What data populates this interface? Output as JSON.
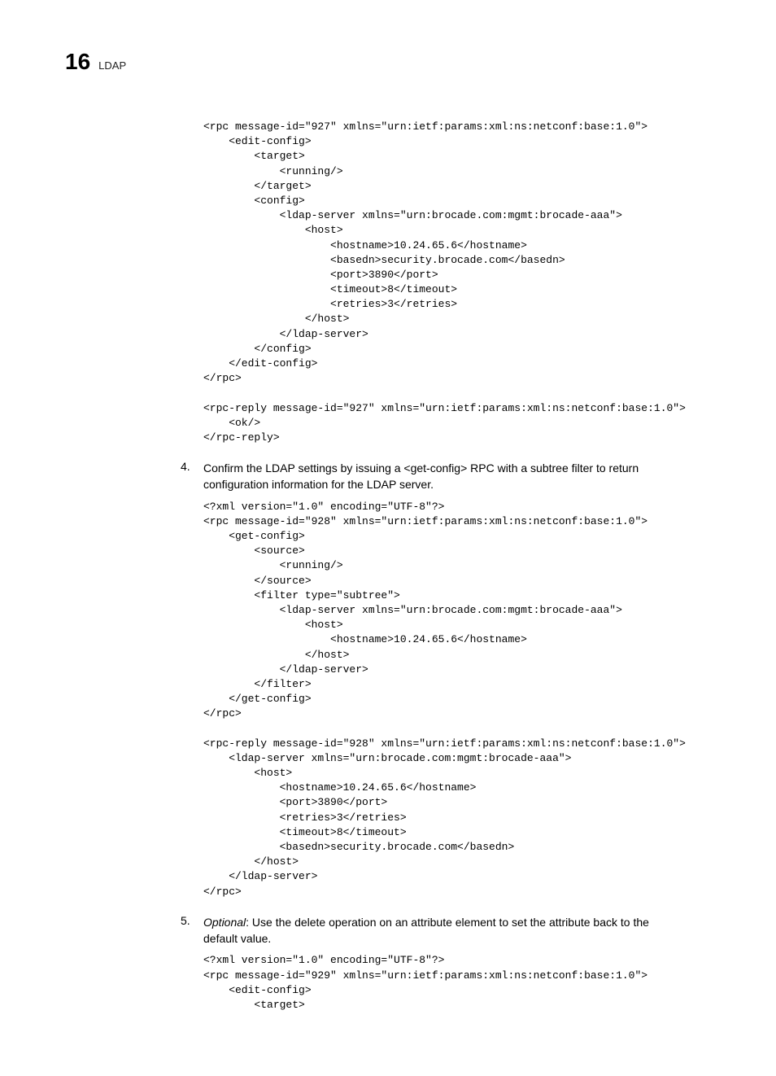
{
  "header": {
    "chapter_number": "16",
    "chapter_title": "LDAP"
  },
  "code_block_1": "<rpc message-id=\"927\" xmlns=\"urn:ietf:params:xml:ns:netconf:base:1.0\">\n    <edit-config>\n        <target>\n            <running/>\n        </target>\n        <config>\n            <ldap-server xmlns=\"urn:brocade.com:mgmt:brocade-aaa\">\n                <host>\n                    <hostname>10.24.65.6</hostname>\n                    <basedn>security.brocade.com</basedn>\n                    <port>3890</port>\n                    <timeout>8</timeout>\n                    <retries>3</retries>\n                </host>\n            </ldap-server>\n        </config>\n    </edit-config>\n</rpc>\n\n<rpc-reply message-id=\"927\" xmlns=\"urn:ietf:params:xml:ns:netconf:base:1.0\">\n    <ok/>\n</rpc-reply>",
  "step_4": {
    "num": "4.",
    "text": "Confirm the LDAP settings by issuing a <get-config> RPC with a subtree filter to return configuration information for the LDAP server."
  },
  "code_block_2": "<?xml version=\"1.0\" encoding=\"UTF-8\"?>\n<rpc message-id=\"928\" xmlns=\"urn:ietf:params:xml:ns:netconf:base:1.0\">\n    <get-config>\n        <source>\n            <running/>\n        </source>\n        <filter type=\"subtree\">\n            <ldap-server xmlns=\"urn:brocade.com:mgmt:brocade-aaa\">\n                <host>\n                    <hostname>10.24.65.6</hostname>\n                </host>\n            </ldap-server>\n        </filter>\n    </get-config>\n</rpc>\n\n<rpc-reply message-id=\"928\" xmlns=\"urn:ietf:params:xml:ns:netconf:base:1.0\">\n    <ldap-server xmlns=\"urn:brocade.com:mgmt:brocade-aaa\">\n        <host>\n            <hostname>10.24.65.6</hostname>\n            <port>3890</port>\n            <retries>3</retries>\n            <timeout>8</timeout>\n            <basedn>security.brocade.com</basedn>\n        </host>\n    </ldap-server>\n</rpc>",
  "step_5": {
    "num": "5.",
    "optional_label": "Optional",
    "text": ": Use the delete operation on an attribute element to set the attribute back to the default value."
  },
  "code_block_3": "<?xml version=\"1.0\" encoding=\"UTF-8\"?>\n<rpc message-id=\"929\" xmlns=\"urn:ietf:params:xml:ns:netconf:base:1.0\">\n    <edit-config>\n        <target>"
}
